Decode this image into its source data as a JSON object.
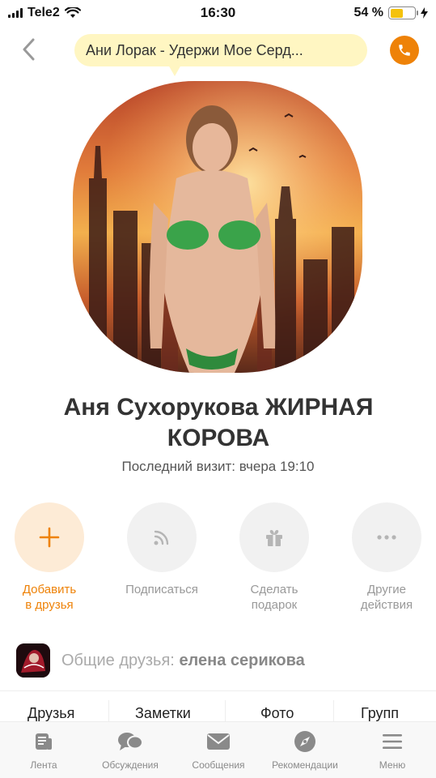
{
  "status_bar": {
    "carrier": "Tele2",
    "time": "16:30",
    "battery_percent": "54 %",
    "battery_level": 0.54
  },
  "header": {
    "music_title": "Ани Лорак - Удержи Мое Серд...",
    "back_icon": "chevron-left-icon",
    "call_icon": "phone-icon"
  },
  "profile": {
    "name": "Аня Сухорукова ЖИРНАЯ КОРОВА",
    "last_visit": "Последний визит: вчера 19:10"
  },
  "actions": [
    {
      "label_line1": "Добавить",
      "label_line2": "в друзья",
      "icon": "plus-icon"
    },
    {
      "label_line1": "Подписаться",
      "label_line2": "",
      "icon": "feed-icon"
    },
    {
      "label_line1": "Сделать",
      "label_line2": "подарок",
      "icon": "gift-icon"
    },
    {
      "label_line1": "Другие",
      "label_line2": "действия",
      "icon": "more-icon"
    }
  ],
  "mutual_friends": {
    "label": "Общие друзья:",
    "name": "елена серикова"
  },
  "tabs": [
    "Друзья",
    "Заметки",
    "Фото",
    "Групп"
  ],
  "bottom_nav": [
    {
      "label": "Лента",
      "icon": "feed-doc-icon"
    },
    {
      "label": "Обсуждения",
      "icon": "chat-bubbles-icon"
    },
    {
      "label": "Сообщения",
      "icon": "envelope-icon"
    },
    {
      "label": "Рекомендации",
      "icon": "compass-icon"
    },
    {
      "label": "Меню",
      "icon": "hamburger-icon"
    }
  ],
  "colors": {
    "accent": "#ee8208",
    "accent_light": "#fdebd6",
    "bubble": "#fff6c2",
    "battery": "#f4c20d"
  }
}
